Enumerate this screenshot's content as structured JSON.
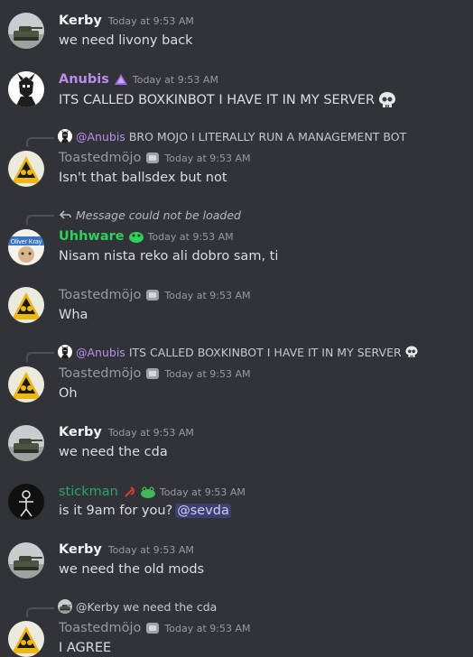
{
  "colors": {
    "background": "#313338",
    "text": "#dbdee1",
    "muted": "#949ba4",
    "anubis": "#b98ee8",
    "uhhware": "#2dd25b",
    "stickman": "#27a76b",
    "kerby": "#f2f3f5",
    "mention_bg": "#5865f24d"
  },
  "messages": [
    {
      "author": "Kerby",
      "timestamp": "Today at 9:53 AM",
      "text": "we need livony back",
      "avatar_icon": "tank-avatar"
    },
    {
      "author": "Anubis",
      "timestamp": "Today at 9:53 AM",
      "text": "ITS CALLED BOXKINBOT I HAVE IT IN MY SERVER",
      "avatar_icon": "anubis-avatar",
      "badge_icon": "purple-role-icon",
      "trail_emoji": "skull-emoji"
    },
    {
      "reply": {
        "author": "@Anubis",
        "text": "BRO MOJO I LITERALLY RUN A MANAGEMENT BOT"
      },
      "author": "Toastedmöjo",
      "timestamp": "Today at 9:53 AM",
      "text": "Isn't that ballsdex but not",
      "avatar_icon": "toastedmojo-avatar",
      "badge_icon": "gray-role-icon"
    },
    {
      "reply": {
        "text": "Message could not be loaded"
      },
      "author": "Uhhware",
      "timestamp": "Today at 9:53 AM",
      "text": "Nisam nista reko ali dobro sam, ti",
      "avatar_icon": "uhhware-avatar",
      "badge_icon": "green-role-icon"
    },
    {
      "author": "Toastedmöjo",
      "timestamp": "Today at 9:53 AM",
      "text": "Wha",
      "avatar_icon": "toastedmojo-avatar",
      "badge_icon": "gray-role-icon"
    },
    {
      "reply": {
        "author": "@Anubis",
        "text": "ITS CALLED BOXKINBOT I HAVE IT IN MY SERVER"
      },
      "author": "Toastedmöjo",
      "timestamp": "Today at 9:53 AM",
      "text": "Oh",
      "avatar_icon": "toastedmojo-avatar",
      "badge_icon": "gray-role-icon"
    },
    {
      "author": "Kerby",
      "timestamp": "Today at 9:53 AM",
      "text": "we need the cda",
      "avatar_icon": "tank-avatar"
    },
    {
      "author": "stickman",
      "timestamp": "Today at 9:53 AM",
      "text": "is it 9am for you?",
      "mention": "@sevda",
      "avatar_icon": "stickman-avatar",
      "badge_icon": "hammer-sickle-icon",
      "badge2_icon": "frog-icon"
    },
    {
      "author": "Kerby",
      "timestamp": "Today at 9:53 AM",
      "text": "we need the old mods",
      "avatar_icon": "tank-avatar"
    },
    {
      "reply": {
        "author": "@Kerby",
        "text": "we need the cda"
      },
      "author": "Toastedmöjo",
      "timestamp": "Today at 9:53 AM",
      "text": "I AGREE",
      "avatar_icon": "toastedmojo-avatar",
      "badge_icon": "gray-role-icon"
    }
  ]
}
